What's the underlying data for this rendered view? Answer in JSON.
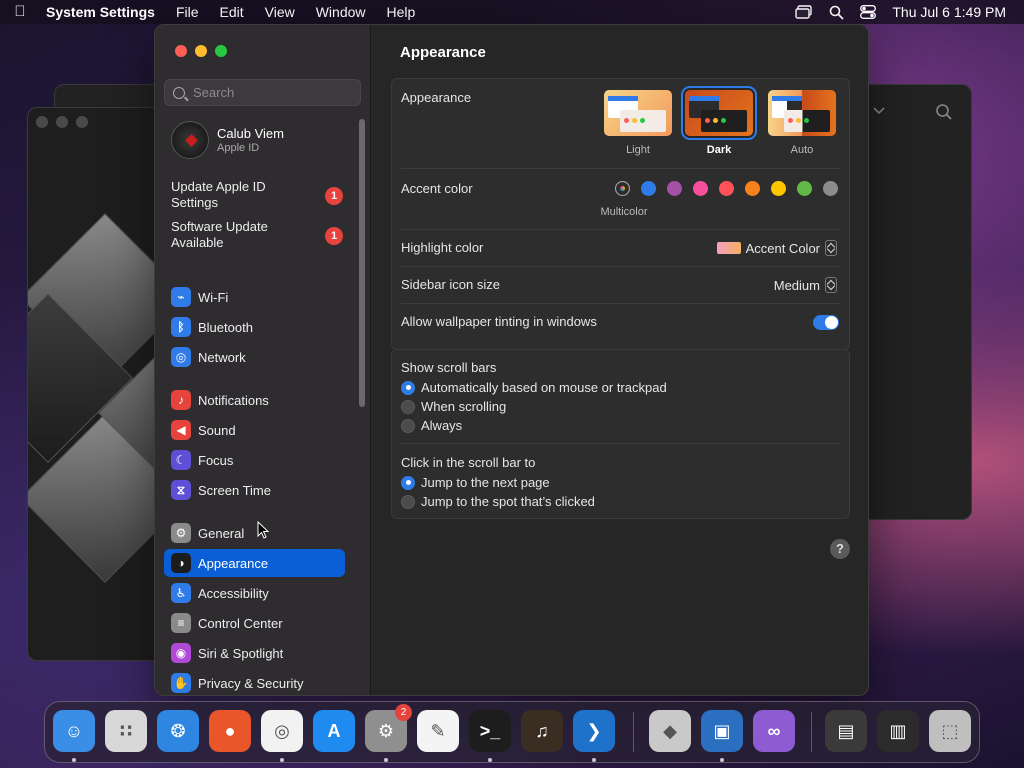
{
  "menubar": {
    "app_name": "System Settings",
    "menus": [
      "File",
      "Edit",
      "View",
      "Window",
      "Help"
    ],
    "clock": "Thu Jul 6  1:49 PM"
  },
  "window": {
    "search_placeholder": "Search",
    "account": {
      "name": "Calub Viem",
      "subtitle": "Apple ID"
    },
    "notices": [
      {
        "label": "Update Apple ID Settings",
        "badge": "1"
      },
      {
        "label": "Software Update Available",
        "badge": "1"
      }
    ],
    "sidebar_items": [
      {
        "label": "Wi-Fi",
        "icon": "wifi-icon",
        "color": "#2f7ce8"
      },
      {
        "label": "Bluetooth",
        "icon": "bluetooth-icon",
        "color": "#2f7ce8"
      },
      {
        "label": "Network",
        "icon": "globe-icon",
        "color": "#2f7ce8"
      },
      {
        "label": "Notifications",
        "icon": "bell-icon",
        "color": "#e5433b"
      },
      {
        "label": "Sound",
        "icon": "speaker-icon",
        "color": "#e5433b"
      },
      {
        "label": "Focus",
        "icon": "moon-icon",
        "color": "#5d4fd6"
      },
      {
        "label": "Screen Time",
        "icon": "hourglass-icon",
        "color": "#5d4fd6"
      },
      {
        "label": "General",
        "icon": "gear-icon",
        "color": "#8a8a8a"
      },
      {
        "label": "Appearance",
        "icon": "appearance-icon",
        "color": "#1c1c1c",
        "selected": true
      },
      {
        "label": "Accessibility",
        "icon": "accessibility-icon",
        "color": "#2f7ce8"
      },
      {
        "label": "Control Center",
        "icon": "toggles-icon",
        "color": "#8a8a8a"
      },
      {
        "label": "Siri & Spotlight",
        "icon": "siri-icon",
        "color": "#b04ad6"
      },
      {
        "label": "Privacy & Security",
        "icon": "hand-icon",
        "color": "#2f7ce8"
      }
    ],
    "content": {
      "title": "Appearance",
      "appearance": {
        "label": "Appearance",
        "options": [
          "Light",
          "Dark",
          "Auto"
        ],
        "selected": "Dark"
      },
      "accent": {
        "label": "Accent color",
        "caption": "Multicolor",
        "colors": [
          "#multicolor",
          "#2f7ce8",
          "#a550a7",
          "#f74f9e",
          "#ff5257",
          "#f7821b",
          "#ffc600",
          "#62ba46",
          "#8c8c8c"
        ]
      },
      "highlight": {
        "label": "Highlight color",
        "value": "Accent Color"
      },
      "sidebar_icon_size": {
        "label": "Sidebar icon size",
        "value": "Medium"
      },
      "wallpaper_tinting": {
        "label": "Allow wallpaper tinting in windows",
        "enabled": true
      },
      "scroll_bars": {
        "label": "Show scroll bars",
        "options": [
          "Automatically based on mouse or trackpad",
          "When scrolling",
          "Always"
        ],
        "selected": "Automatically based on mouse or trackpad"
      },
      "click_scroll": {
        "label": "Click in the scroll bar to",
        "options": [
          "Jump to the next page",
          "Jump to the spot that’s clicked"
        ],
        "selected": "Jump to the next page"
      },
      "help_label": "?"
    }
  },
  "dock": {
    "apps": [
      {
        "name": "finder-icon",
        "color": "#3a8ee6",
        "running": true
      },
      {
        "name": "launchpad-icon",
        "color": "#d8d8d8",
        "running": false
      },
      {
        "name": "safari-icon",
        "color": "#2f86e0",
        "running": false
      },
      {
        "name": "firefox-icon",
        "color": "#e8562a",
        "running": false
      },
      {
        "name": "chrome-icon",
        "color": "#f2f2f2",
        "running": true
      },
      {
        "name": "app-store-icon",
        "color": "#1f8bf0",
        "running": false
      },
      {
        "name": "system-settings-icon",
        "color": "#8f8f8f",
        "running": true,
        "badge": "2"
      },
      {
        "name": "textedit-icon",
        "color": "#f4f4f4",
        "running": false
      },
      {
        "name": "terminal-icon",
        "color": "#1d1d1d",
        "running": true
      },
      {
        "name": "garageband-icon",
        "color": "#3a2d22",
        "running": false
      },
      {
        "name": "vscode-icon",
        "color": "#1f72c9",
        "running": true
      },
      {
        "name": "boot-camp-icon",
        "color": "#c9c9c9",
        "running": false
      },
      {
        "name": "remote-desktop-icon",
        "color": "#2a6fc0",
        "running": true
      },
      {
        "name": "visual-studio-icon",
        "color": "#8d5cd3",
        "running": false
      },
      {
        "name": "stack-windows-icon",
        "color": "#3a3a3a",
        "running": false
      },
      {
        "name": "stack-screens-icon",
        "color": "#2b2b2b",
        "running": false
      },
      {
        "name": "trash-icon",
        "color": "#bfbfbf",
        "running": false
      }
    ]
  }
}
